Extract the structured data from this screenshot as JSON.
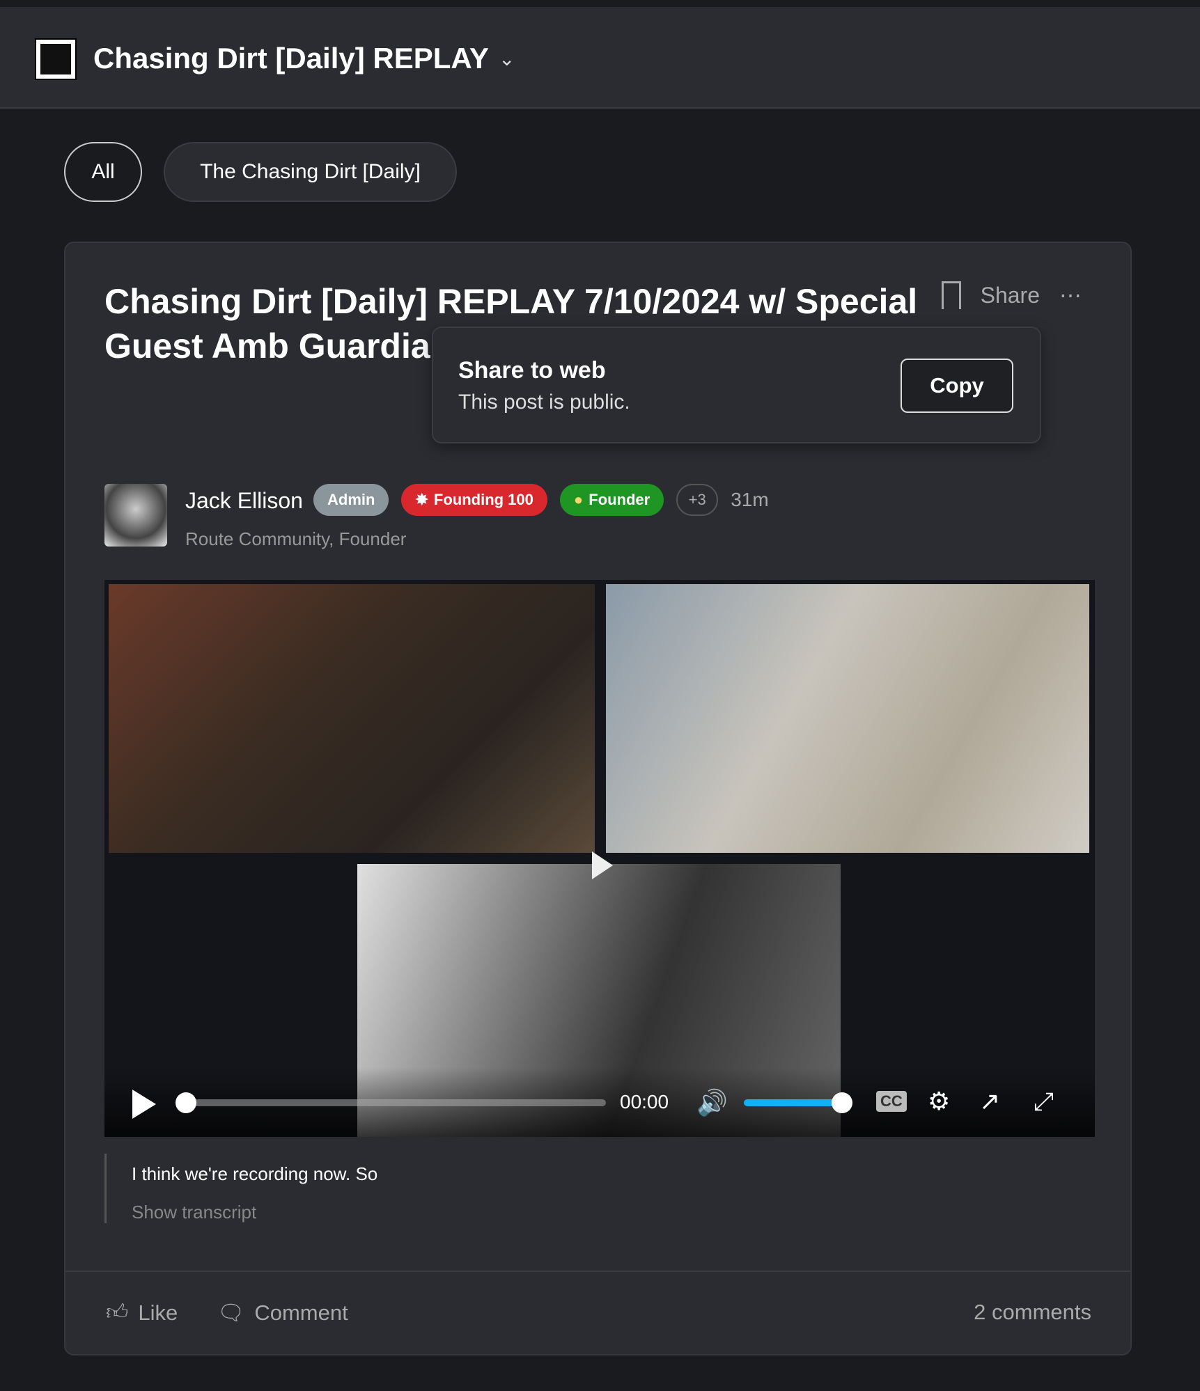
{
  "header": {
    "title": "Chasing Dirt [Daily] REPLAY"
  },
  "filters": [
    {
      "label": "All",
      "selected": true
    },
    {
      "label": "The Chasing Dirt [Daily]",
      "selected": false
    }
  ],
  "post": {
    "title": "Chasing Dirt [Daily] REPLAY 7/10/2024 w/ Special Guest Amb GuardianSaints Co Texas]",
    "share_label": "Share",
    "share_popup": {
      "heading": "Share to web",
      "subtext": "This post is public.",
      "copy_label": "Copy"
    },
    "author": {
      "name": "Jack Ellison",
      "role": "Route Community, Founder",
      "time": "31m"
    },
    "badges": [
      {
        "label": "Admin",
        "color": "#8a969c"
      },
      {
        "label": "Founding 100",
        "color": "#d8282e",
        "icon": "star-icon"
      },
      {
        "label": "Founder",
        "color": "#1f9524",
        "icon": "lightbulb-icon"
      },
      {
        "label": "+3"
      }
    ],
    "video": {
      "time": "00:00",
      "progress": 0,
      "volume": 1.0,
      "accent": "#12b0f5"
    },
    "transcript": {
      "quote": "I think we're recording now. So",
      "show_label": "Show transcript"
    },
    "footer": {
      "like": "Like",
      "comment": "Comment",
      "comments_count": "2 comments"
    }
  }
}
